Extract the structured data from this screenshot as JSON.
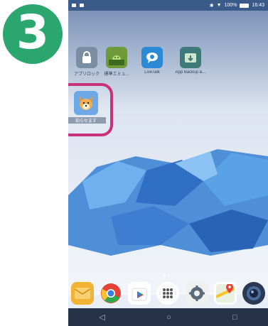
{
  "step": {
    "number": "3"
  },
  "status_bar": {
    "battery": "100%",
    "time": "16:43"
  },
  "apps": [
    {
      "label": "アプリロック",
      "icon": "app-lock-icon"
    },
    {
      "label": "標準エミュ...",
      "icon": "android-emulator-icon"
    },
    {
      "label": "LiveTalk",
      "icon": "livetalk-icon"
    },
    {
      "label": "App Backup &...",
      "icon": "app-backup-icon"
    },
    {
      "label": "知らせます",
      "icon": "shiba-dog-app-icon"
    }
  ],
  "dock": [
    {
      "icon": "email-icon"
    },
    {
      "icon": "chrome-icon"
    },
    {
      "icon": "play-store-icon"
    },
    {
      "icon": "app-drawer-icon"
    },
    {
      "icon": "settings-icon"
    },
    {
      "icon": "maps-icon"
    },
    {
      "icon": "camera-icon"
    }
  ],
  "nav": {
    "back": "◁",
    "home": "○",
    "recents": "□"
  },
  "colors": {
    "badge": "#2ba66e",
    "highlight": "#c8327a"
  }
}
